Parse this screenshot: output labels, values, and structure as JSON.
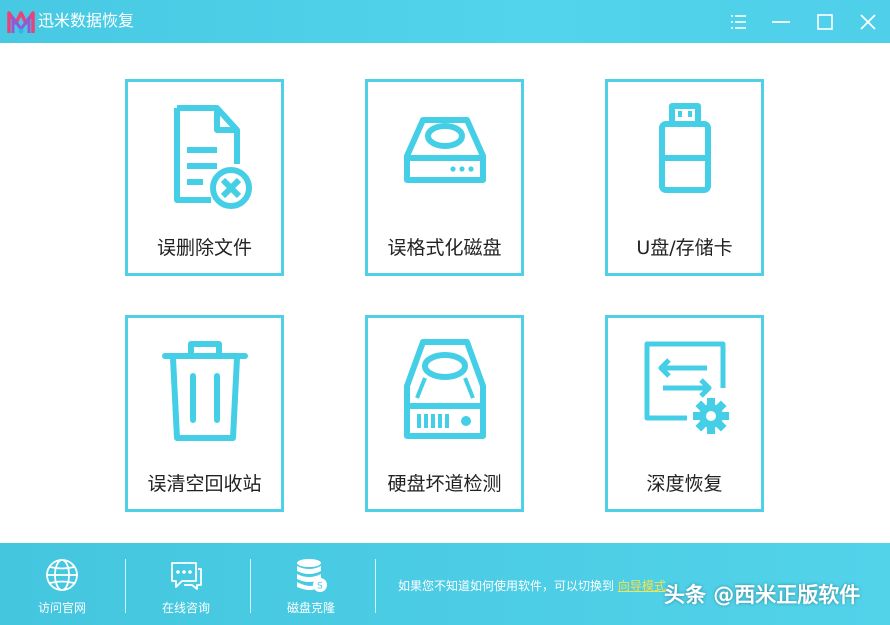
{
  "app": {
    "title": "迅米数据恢复",
    "logo_icon": "xunmi-logo",
    "accent_color": "#4fd0e6"
  },
  "window_controls": {
    "menu_icon": "menu-icon",
    "minimize_icon": "minimize-icon",
    "maximize_icon": "maximize-icon",
    "close_icon": "close-icon"
  },
  "cards": [
    {
      "label": "误删除文件",
      "icon": "deleted-file-icon"
    },
    {
      "label": "误格式化磁盘",
      "icon": "format-disk-icon"
    },
    {
      "label": "U盘/存储卡",
      "icon": "usb-drive-icon"
    },
    {
      "label": "误清空回收站",
      "icon": "recycle-bin-icon"
    },
    {
      "label": "硬盘坏道检测",
      "icon": "hard-disk-check-icon"
    },
    {
      "label": "深度恢复",
      "icon": "deep-recovery-icon"
    }
  ],
  "footer": {
    "buttons": [
      {
        "label": "访问官网",
        "icon": "globe-icon"
      },
      {
        "label": "在线咨询",
        "icon": "chat-icon"
      },
      {
        "label": "磁盘克隆",
        "icon": "disk-clone-icon"
      }
    ],
    "hint_text": "如果您不知道如何使用软件，可以切换到",
    "hint_link": "向导模式"
  },
  "watermark": "头条 @西米正版软件"
}
